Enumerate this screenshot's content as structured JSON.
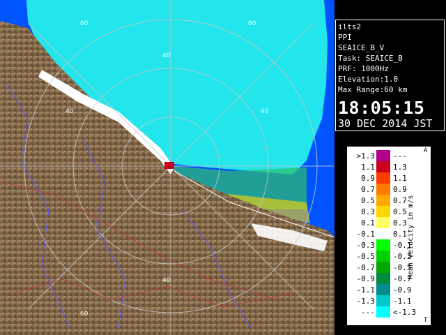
{
  "info": {
    "lines": [
      "ilts2",
      "PPI",
      "SEAICE_B_V",
      "Task: SEAICE_B",
      "PRF: 1000Hz",
      "Elevation:1.0",
      "Max Range:60 km"
    ],
    "time": "18:05:15",
    "date": "30 DEC 2014 JST"
  },
  "legend": {
    "unit": "Mean Velocity in m/s",
    "top_mark": "A",
    "bottom_mark": "T",
    "rows": [
      {
        "left": ">1.3",
        "right": "---",
        "color": "#b0008a"
      },
      {
        "left": "1.1",
        "right": "1.3",
        "color": "#c8001e"
      },
      {
        "left": "0.9",
        "right": "1.1",
        "color": "#ff3c00"
      },
      {
        "left": "0.7",
        "right": "0.9",
        "color": "#ff7800"
      },
      {
        "left": "0.5",
        "right": "0.7",
        "color": "#ffa800"
      },
      {
        "left": "0.3",
        "right": "0.5",
        "color": "#ffd600"
      },
      {
        "left": "0.1",
        "right": "0.3",
        "color": "#ffff64"
      },
      {
        "left": "-0.1",
        "right": "0.1",
        "color": "#ffffff"
      },
      {
        "left": "-0.3",
        "right": "-0.1",
        "color": "#00ff00"
      },
      {
        "left": "-0.5",
        "right": "-0.3",
        "color": "#00d000"
      },
      {
        "left": "-0.7",
        "right": "-0.5",
        "color": "#00a800"
      },
      {
        "left": "-0.9",
        "right": "-0.7",
        "color": "#008a3c"
      },
      {
        "left": "-1.1",
        "right": "-0.9",
        "color": "#008c8c"
      },
      {
        "left": "-1.3",
        "right": "-1.1",
        "color": "#00c8c8"
      },
      {
        "left": "---",
        "right": "<-1.3",
        "color": "#00ffff"
      }
    ]
  },
  "map": {
    "range_labels": [
      "60",
      "60",
      "40",
      "40",
      "40",
      "40",
      "60"
    ],
    "colors": {
      "sea": "#0054ff",
      "ice": "#22e6ec",
      "land": "#8a6e4e",
      "ring": "#c8c8c8"
    }
  }
}
